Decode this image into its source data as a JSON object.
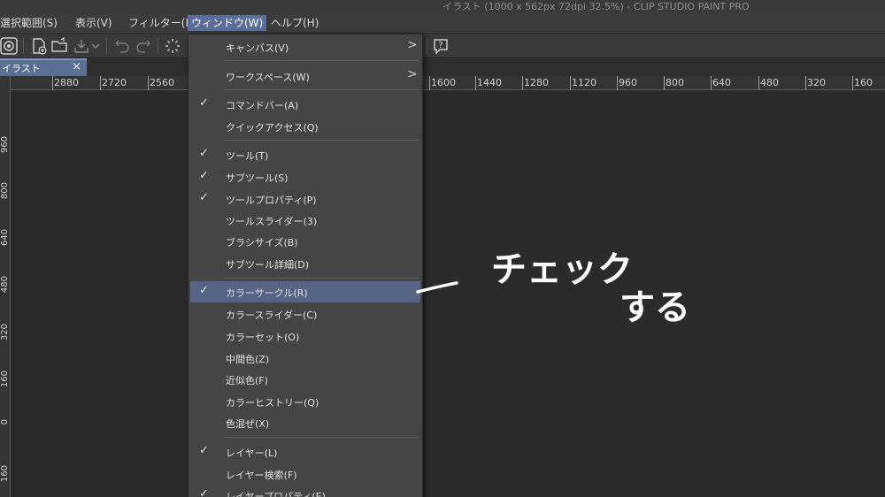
{
  "window": {
    "title": "イラスト (1000 x 562px 72dpi 32.5%)  - CLIP STUDIO PAINT PRO"
  },
  "menubar": {
    "items": [
      {
        "label": "選択範囲(S)"
      },
      {
        "label": "表示(V)"
      },
      {
        "label": "フィルター(I)"
      },
      {
        "label": "ウィンドウ(W)"
      },
      {
        "label": "ヘルプ(H)"
      }
    ],
    "active_index": 3
  },
  "document_tab": {
    "label": "イラスト",
    "close": "×"
  },
  "ruler": {
    "top": [
      "2880",
      "2720",
      "2560",
      "1600",
      "1440",
      "1280",
      "1120",
      "960",
      "800",
      "640",
      "480",
      "320",
      "160"
    ],
    "left": [
      "960",
      "800",
      "640",
      "480",
      "320",
      "160",
      "0",
      "160"
    ]
  },
  "window_menu": {
    "checkmark_glyph": "✓",
    "submenu_glyph": ">",
    "items": [
      {
        "label": "キャンバス(V)",
        "checked": false,
        "submenu": true
      },
      {
        "label": "ワークスペース(W)",
        "checked": false,
        "submenu": true
      },
      {
        "label": "コマンドバー(A)",
        "checked": true
      },
      {
        "label": "クイックアクセス(Q)",
        "checked": false
      },
      {
        "label": "ツール(T)",
        "checked": true
      },
      {
        "label": "サブツール(S)",
        "checked": true
      },
      {
        "label": "ツールプロパティ(P)",
        "checked": true
      },
      {
        "label": "ツールスライダー(3)",
        "checked": false
      },
      {
        "label": "ブラシサイズ(B)",
        "checked": false
      },
      {
        "label": "サブツール詳細(D)",
        "checked": false
      },
      {
        "label": "カラーサークル(R)",
        "checked": true,
        "highlighted": true
      },
      {
        "label": "カラースライダー(C)",
        "checked": false
      },
      {
        "label": "カラーセット(O)",
        "checked": false
      },
      {
        "label": "中間色(Z)",
        "checked": false
      },
      {
        "label": "近似色(F)",
        "checked": false
      },
      {
        "label": "カラーヒストリー(Q)",
        "checked": false
      },
      {
        "label": "色混ぜ(X)",
        "checked": false
      },
      {
        "label": "レイヤー(L)",
        "checked": true
      },
      {
        "label": "レイヤー検索(F)",
        "checked": false
      },
      {
        "label": "レイヤープロパティ(E)",
        "checked": true
      }
    ]
  },
  "annotation": {
    "line1": "チェック",
    "line2": "する"
  },
  "colors": {
    "accent": "#5d6d9a",
    "highlight": "#586485",
    "menu_bg": "#454545",
    "app_bg": "#2b2b2b"
  }
}
